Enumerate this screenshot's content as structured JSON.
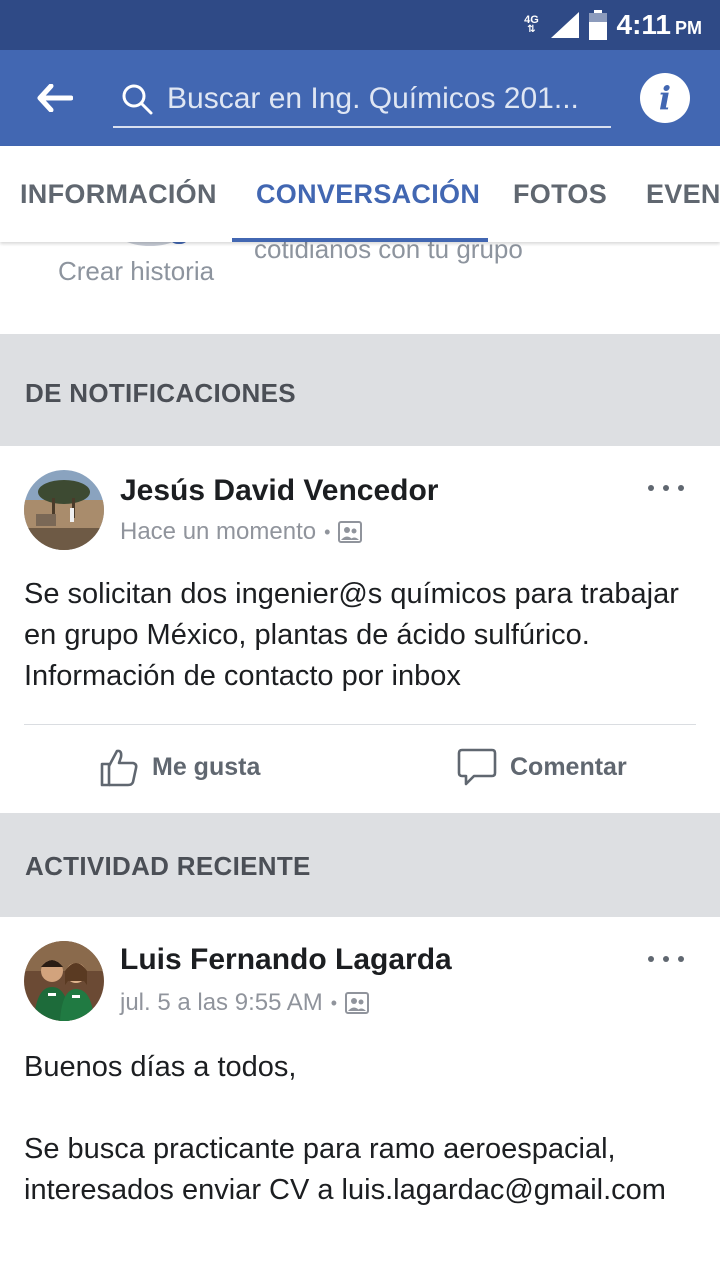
{
  "status_bar": {
    "network_label": "4G",
    "time": "4:11",
    "ampm": "PM"
  },
  "app_bar": {
    "search_text": "Buscar en Ing. Químicos 201..."
  },
  "tabs": [
    {
      "label": "INFORMACIÓN",
      "active": false
    },
    {
      "label": "CONVERSACIÓN",
      "active": true
    },
    {
      "label": "FOTOS",
      "active": false
    },
    {
      "label": "EVENT",
      "active": false
    }
  ],
  "stories": {
    "create_label": "Crear historia",
    "partial_text": "cotidianos con tu grupo"
  },
  "sections": {
    "notifications_header": "DE NOTIFICACIONES",
    "recent_header": "ACTIVIDAD RECIENTE"
  },
  "posts": [
    {
      "author": "Jesús David Vencedor",
      "time": "Hace un momento",
      "body": "Se solicitan dos ingenier@s químicos para trabajar en grupo México, plantas de ácido sulfúrico. Información de contacto por inbox",
      "like_label": "Me gusta",
      "comment_label": "Comentar"
    },
    {
      "author": "Luis Fernando Lagarda",
      "time": "jul. 5 a las 9:55 AM",
      "body_line1": "Buenos días a todos,",
      "body_line2": "Se busca practicante para ramo aeroespacial, interesados enviar CV a luis.lagardac@gmail.com"
    }
  ],
  "colors": {
    "brand_blue": "#4267b2",
    "status_bar": "#2f4a86",
    "section_gray": "#dddfe2"
  }
}
